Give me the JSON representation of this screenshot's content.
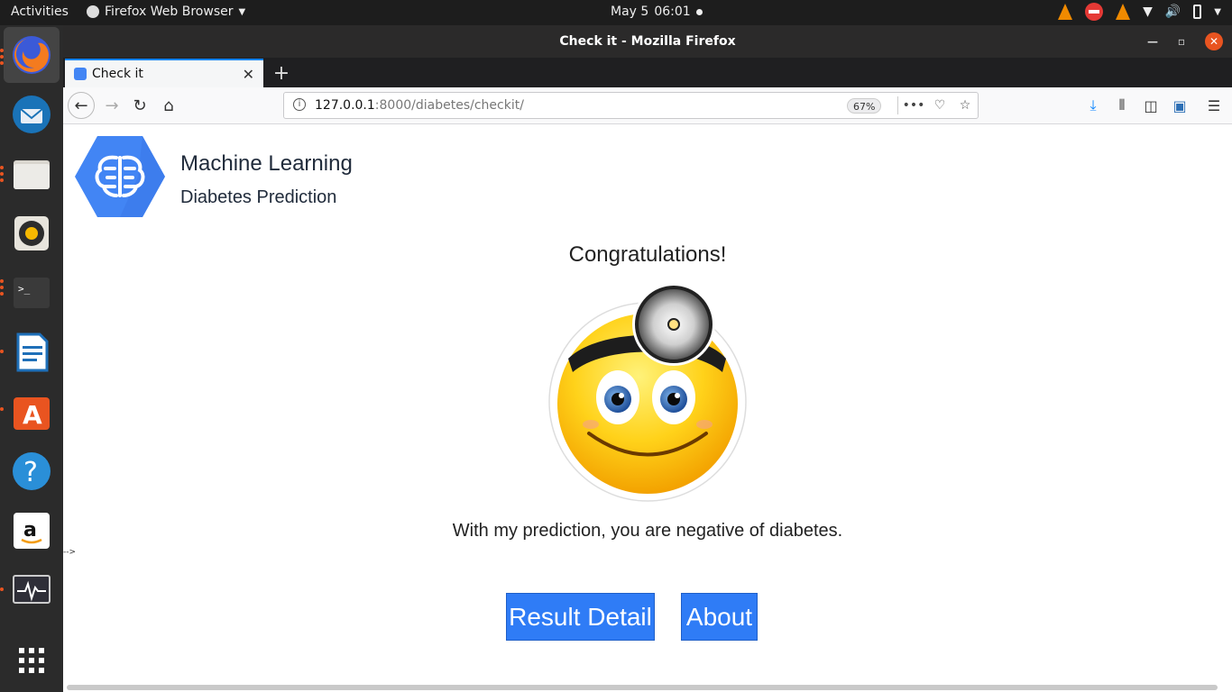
{
  "topbar": {
    "activities": "Activities",
    "app_name": "Firefox Web Browser",
    "date": "May 5",
    "time": "06:01"
  },
  "window": {
    "title": "Check it - Mozilla Firefox"
  },
  "tabs": [
    {
      "label": "Check it"
    }
  ],
  "urlbar": {
    "host": "127.0.0.1",
    "rest": ":8000/diabetes/checkit/",
    "zoom": "67%"
  },
  "page": {
    "brand_title": "Machine Learning",
    "brand_subtitle": "Diabetes Prediction",
    "heading": "Congratulations!",
    "message": "With my prediction, you are negative of diabetes.",
    "stray_text": "-->",
    "buttons": {
      "result_detail": "Result Detail",
      "about": "About"
    }
  },
  "colors": {
    "button_bg": "#2f7cf6",
    "logo_blue": "#4285f4",
    "ubuntu_orange": "#e95420"
  },
  "icons": {
    "dock": [
      "firefox-icon",
      "thunderbird-icon",
      "files-icon",
      "rhythmbox-icon",
      "terminal-icon",
      "writer-icon",
      "software-icon",
      "help-icon",
      "amazon-icon",
      "system-monitor-icon",
      "show-apps-icon"
    ]
  }
}
